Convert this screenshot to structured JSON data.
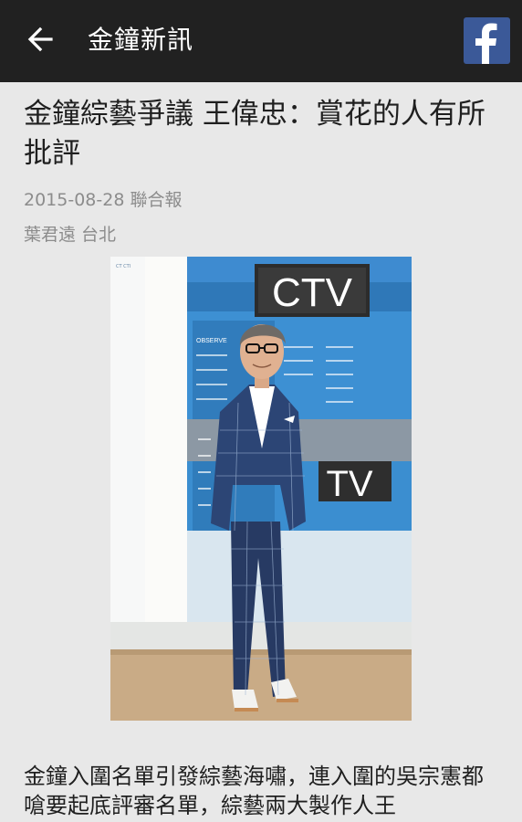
{
  "appbar": {
    "title": "金鐘新訊",
    "back_icon": "arrow-left-icon",
    "share_icon": "facebook-icon",
    "background": "#212121",
    "facebook_color": "#3b5998"
  },
  "article": {
    "headline": "金鐘綜藝爭議 王偉忠：賞花的人有所批評",
    "date_source": "2015-08-28 聯合報",
    "author_location": "葉君遠 台北",
    "photo": {
      "backdrop_logo_main": "CTV",
      "backdrop_logo_secondary": "TV",
      "backdrop_word": "OBSERVE",
      "side_label": "CT CTI"
    },
    "body": "金鐘入圍名單引發綜藝海嘯，連入圍的吳宗憲都嗆要起底評審名單，綜藝兩大製作人王"
  }
}
